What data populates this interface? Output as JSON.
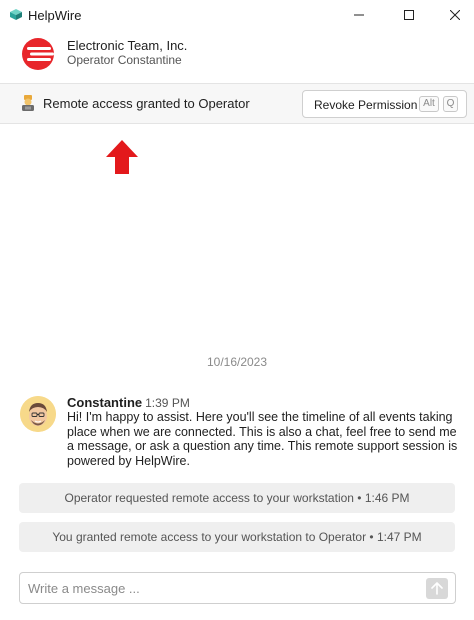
{
  "window": {
    "title": "HelpWire"
  },
  "header": {
    "company": "Electronic Team, Inc.",
    "operator": "Operator Constantine"
  },
  "banner": {
    "status_text": "Remote access granted to Operator",
    "revoke_label": "Revoke Permission",
    "shortcut_keys": [
      "Alt",
      "Q"
    ]
  },
  "chat": {
    "date": "10/16/2023",
    "message": {
      "author": "Constantine",
      "time": "1:39 PM",
      "text": "Hi! I'm happy to assist. Here you'll see the timeline of all events taking place when we are connected. This is also a chat, feel free to send me a message, or ask a question any time. This remote support session is powered by HelpWire."
    },
    "events": [
      "Operator requested remote access to your workstation • 1:46 PM",
      "You granted remote access to your workstation to Operator • 1:47 PM"
    ]
  },
  "composer": {
    "placeholder": "Write a message ..."
  },
  "colors": {
    "brand_red": "#e8262b",
    "arrow_red": "#e3191c"
  },
  "icons": {
    "app": "helpwire-logo-icon",
    "banner": "operator-access-icon",
    "send": "send-arrow-icon"
  }
}
